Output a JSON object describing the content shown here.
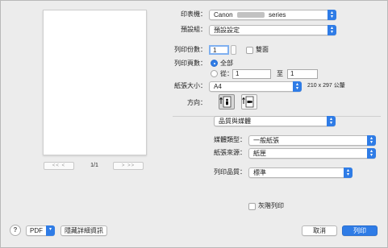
{
  "printer": {
    "label": "印表機：",
    "name_prefix": "Canon",
    "name_suffix": "series"
  },
  "presets": {
    "label": "預設組：",
    "value": "預設設定"
  },
  "copies": {
    "label": "列印份數：",
    "value": "1",
    "two_sided_label": "雙面"
  },
  "pages": {
    "label": "列印頁數：",
    "all_label": "全部",
    "from_label": "從：",
    "from_value": "1",
    "to_label": "至",
    "to_value": "1"
  },
  "paper_size": {
    "label": "紙張大小：",
    "value": "A4",
    "dimensions": "210 x 297 公釐"
  },
  "orientation": {
    "label": "方向："
  },
  "section_menu": {
    "value": "品質與媒體"
  },
  "media_type": {
    "label": "媒體類型：",
    "value": "一般紙張"
  },
  "paper_source": {
    "label": "紙張來源：",
    "value": "紙匣"
  },
  "print_quality": {
    "label": "列印品質：",
    "value": "標準"
  },
  "grayscale": {
    "label": "灰階列印"
  },
  "preview": {
    "page_indicator": "1/1",
    "first_prev": "<< <",
    "next_last": "> >>"
  },
  "footer": {
    "help": "?",
    "pdf_label": "PDF",
    "hide_details": "隱藏詳細資訊",
    "cancel": "取消",
    "print": "列印"
  },
  "colors": {
    "accent": "#2f7ce6",
    "background": "#ececec"
  }
}
